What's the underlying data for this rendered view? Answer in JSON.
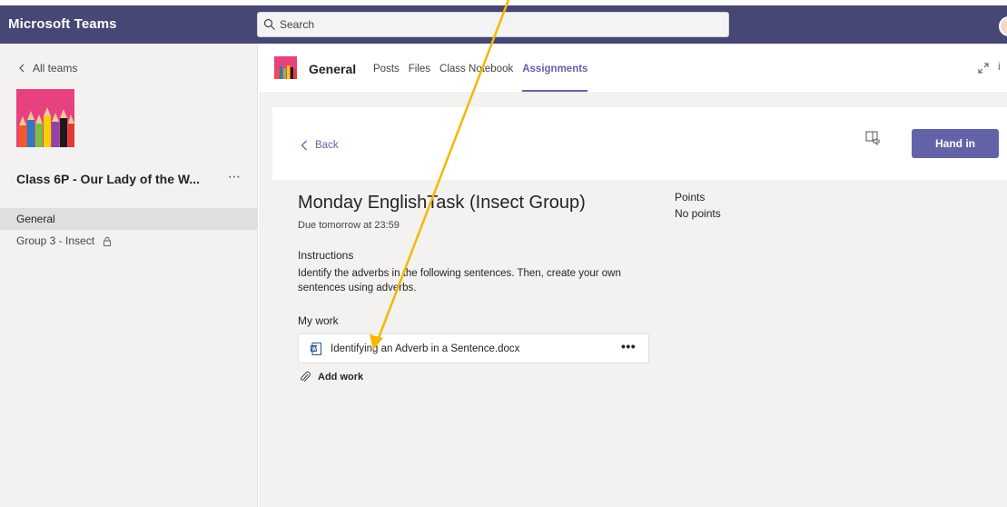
{
  "app": {
    "title": "Microsoft Teams"
  },
  "search": {
    "placeholder": "Search"
  },
  "left_panel": {
    "all_teams_label": "All teams",
    "team_name": "Class 6P - Our Lady of the W...",
    "more_label": "⋯",
    "channels": [
      {
        "label": "General",
        "active": true
      },
      {
        "label": "Group 3 - Insect",
        "locked": true
      }
    ]
  },
  "header": {
    "channel_title": "General",
    "tabs": [
      {
        "label": "Posts"
      },
      {
        "label": "Files"
      },
      {
        "label": "Class Notebook"
      },
      {
        "label": "Assignments",
        "active": true
      }
    ]
  },
  "assignment": {
    "back_label": "Back",
    "hand_in_label": "Hand in",
    "title": "Monday EnglishTask (Insect Group)",
    "due": "Due tomorrow at 23:59",
    "instructions_label": "Instructions",
    "instructions_text": "Identify the adverbs in the following sentences. Then, create your own sentences using adverbs.",
    "my_work_label": "My work",
    "file_name": "Identifying an Adverb in a Sentence.docx",
    "file_more": "•••",
    "add_work_label": "Add work",
    "points_label": "Points",
    "points_value": "No points"
  },
  "colors": {
    "topbar": "#464775",
    "accent": "#6264a7",
    "annotation_arrow": "#f5b800"
  },
  "icons": [
    "search-icon",
    "chevron-left-icon",
    "lock-icon",
    "expand-icon",
    "info-icon",
    "immersive-reader-icon",
    "word-file-icon",
    "paperclip-icon",
    "more-icon"
  ]
}
